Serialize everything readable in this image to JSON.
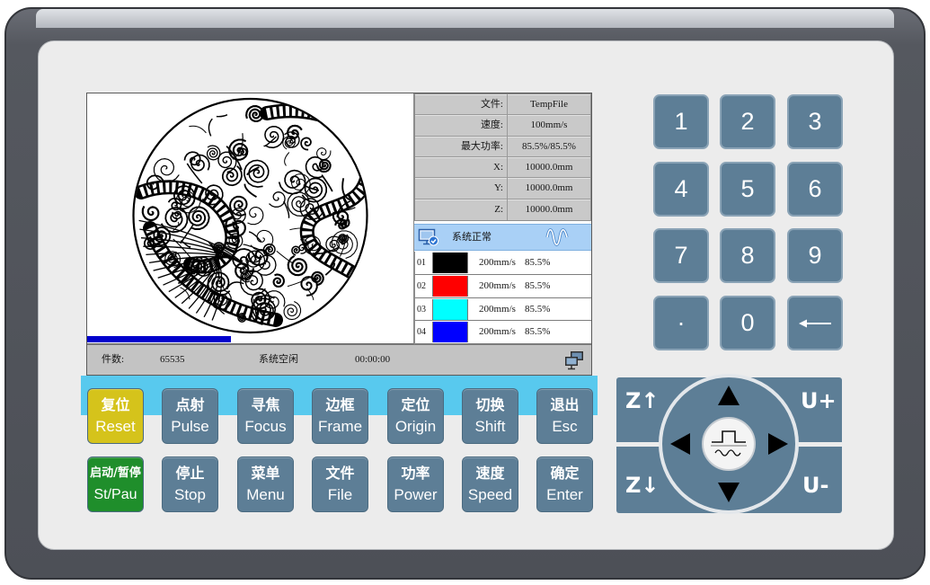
{
  "screen": {
    "preview": {
      "progress": 0.44
    },
    "info": [
      {
        "label": "文件:",
        "value": "TempFile"
      },
      {
        "label": "速度:",
        "value": "100mm/s"
      },
      {
        "label": "最大功率:",
        "value": "85.5%/85.5%"
      },
      {
        "label": "X:",
        "value": "10000.0mm"
      },
      {
        "label": "Y:",
        "value": "10000.0mm"
      },
      {
        "label": "Z:",
        "value": "10000.0mm"
      }
    ],
    "status": {
      "text": "系统正常",
      "icon": "monitor-check-icon",
      "wave_icon": "sine-wave-icon"
    },
    "layers": [
      {
        "index": "01",
        "color": "#000000",
        "speed": "200mm/s",
        "power": "85.5%"
      },
      {
        "index": "02",
        "color": "#ff0000",
        "speed": "200mm/s",
        "power": "85.5%"
      },
      {
        "index": "03",
        "color": "#00ffff",
        "speed": "200mm/s",
        "power": "85.5%"
      },
      {
        "index": "04",
        "color": "#0000ff",
        "speed": "200mm/s",
        "power": "85.5%"
      }
    ],
    "footer": {
      "count_label": "件数:",
      "count_value": "65535",
      "state": "系统空闲",
      "time": "00:00:00",
      "icon": "network-computers-icon"
    }
  },
  "function_keys": [
    [
      {
        "cn": "复位",
        "en": "Reset",
        "color": "#d5c31b"
      },
      {
        "cn": "点射",
        "en": "Pulse"
      },
      {
        "cn": "寻焦",
        "en": "Focus"
      },
      {
        "cn": "边框",
        "en": "Frame"
      },
      {
        "cn": "定位",
        "en": "Origin"
      },
      {
        "cn": "切换",
        "en": "Shift"
      },
      {
        "cn": "退出",
        "en": "Esc"
      }
    ],
    [
      {
        "cn": "启动/暂停",
        "en": "St/Pau",
        "color": "#1f8e2b"
      },
      {
        "cn": "停止",
        "en": "Stop"
      },
      {
        "cn": "菜单",
        "en": "Menu"
      },
      {
        "cn": "文件",
        "en": "File"
      },
      {
        "cn": "功率",
        "en": "Power"
      },
      {
        "cn": "速度",
        "en": "Speed"
      },
      {
        "cn": "确定",
        "en": "Enter"
      }
    ]
  ],
  "numpad": [
    {
      "label": "1"
    },
    {
      "label": "2"
    },
    {
      "label": "3"
    },
    {
      "label": "4"
    },
    {
      "label": "5"
    },
    {
      "label": "6"
    },
    {
      "label": "7"
    },
    {
      "label": "8"
    },
    {
      "label": "9"
    },
    {
      "label": "·"
    },
    {
      "label": "0"
    },
    {
      "icon": "long-left-arrow-icon"
    }
  ],
  "dpad": {
    "z_up": "Z↑",
    "u_plus": "U+",
    "z_down": "Z↓",
    "u_minus": "U-",
    "arrows": [
      "arrow-up-icon",
      "arrow-down-icon",
      "arrow-left-icon",
      "arrow-right-icon"
    ],
    "center_icon": "pulse-wave-icon"
  },
  "theme": {
    "key": "#5d7e96",
    "status_row": "#a9d0f6",
    "progress": "#0000cc",
    "accent_band": "#58c9ee"
  }
}
